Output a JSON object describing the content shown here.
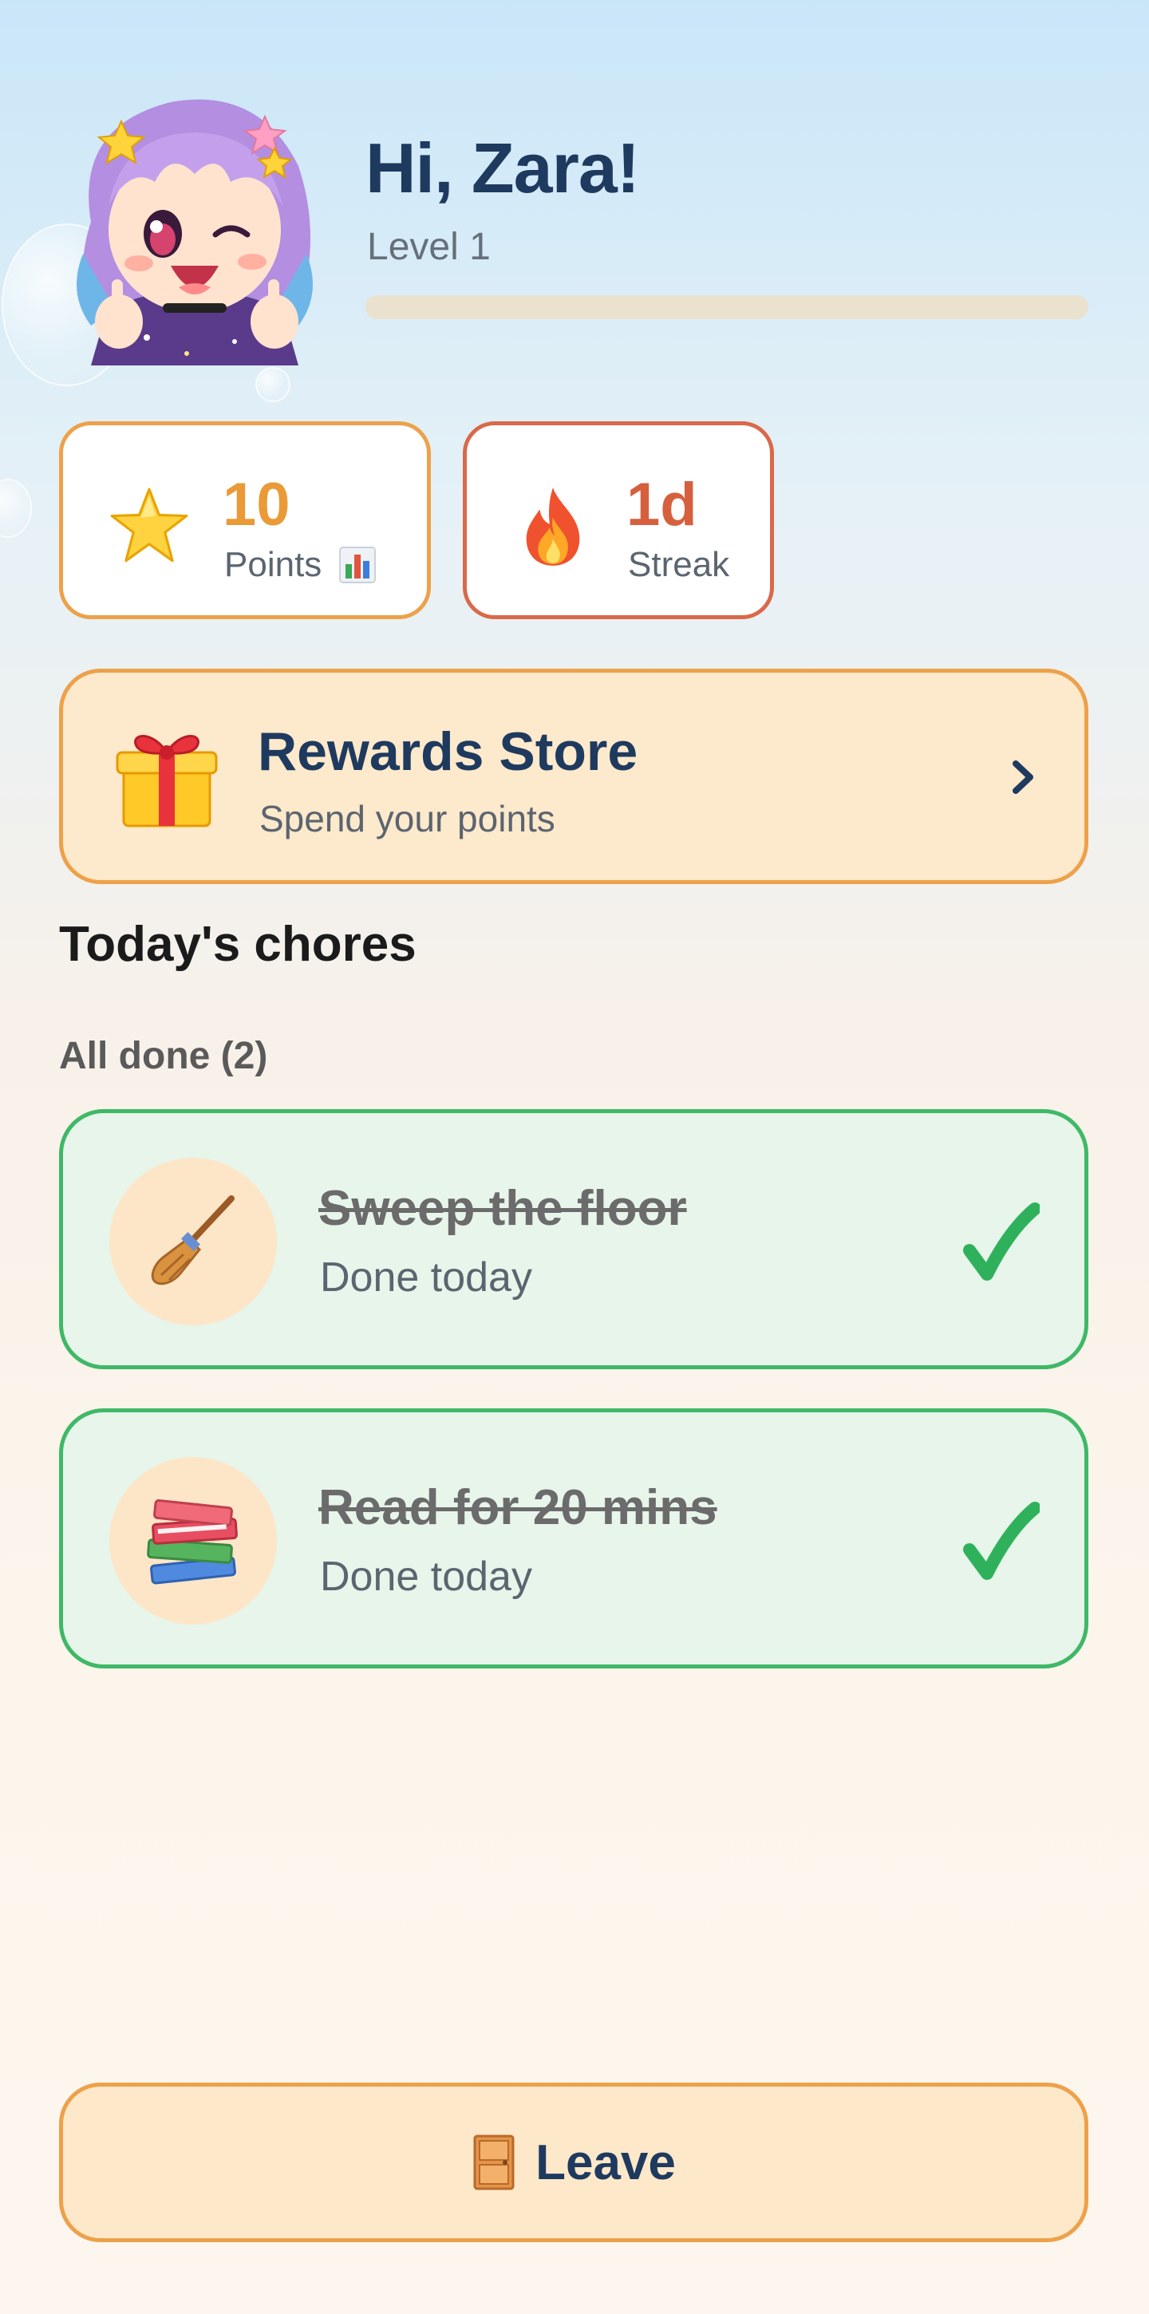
{
  "header": {
    "greeting": "Hi, Zara!",
    "level": "Level 1",
    "level_progress": 0
  },
  "stats": {
    "points": {
      "value": "10",
      "label": "Points",
      "icon": "star-icon",
      "secondary_icon": "bar-chart-icon"
    },
    "streak": {
      "value": "1d",
      "label": "Streak",
      "icon": "fire-icon"
    }
  },
  "rewards": {
    "title": "Rewards Store",
    "subtitle": "Spend your points",
    "icon": "gift-icon"
  },
  "chores": {
    "section_title": "Today's chores",
    "group_label": "All done (2)",
    "items": [
      {
        "title": "Sweep the floor",
        "status": "Done today",
        "icon": "broom-icon"
      },
      {
        "title": "Read for 20 mins",
        "status": "Done today",
        "icon": "books-icon"
      }
    ]
  },
  "footer": {
    "leave_label": "Leave",
    "leave_icon": "door-icon"
  },
  "colors": {
    "navy": "#1f3a5f",
    "orange": "#eda14a",
    "streak_red": "#d9694a",
    "done_green": "#3fb867",
    "card_cream": "#fde9cb",
    "done_bg": "#e7f5ea"
  }
}
